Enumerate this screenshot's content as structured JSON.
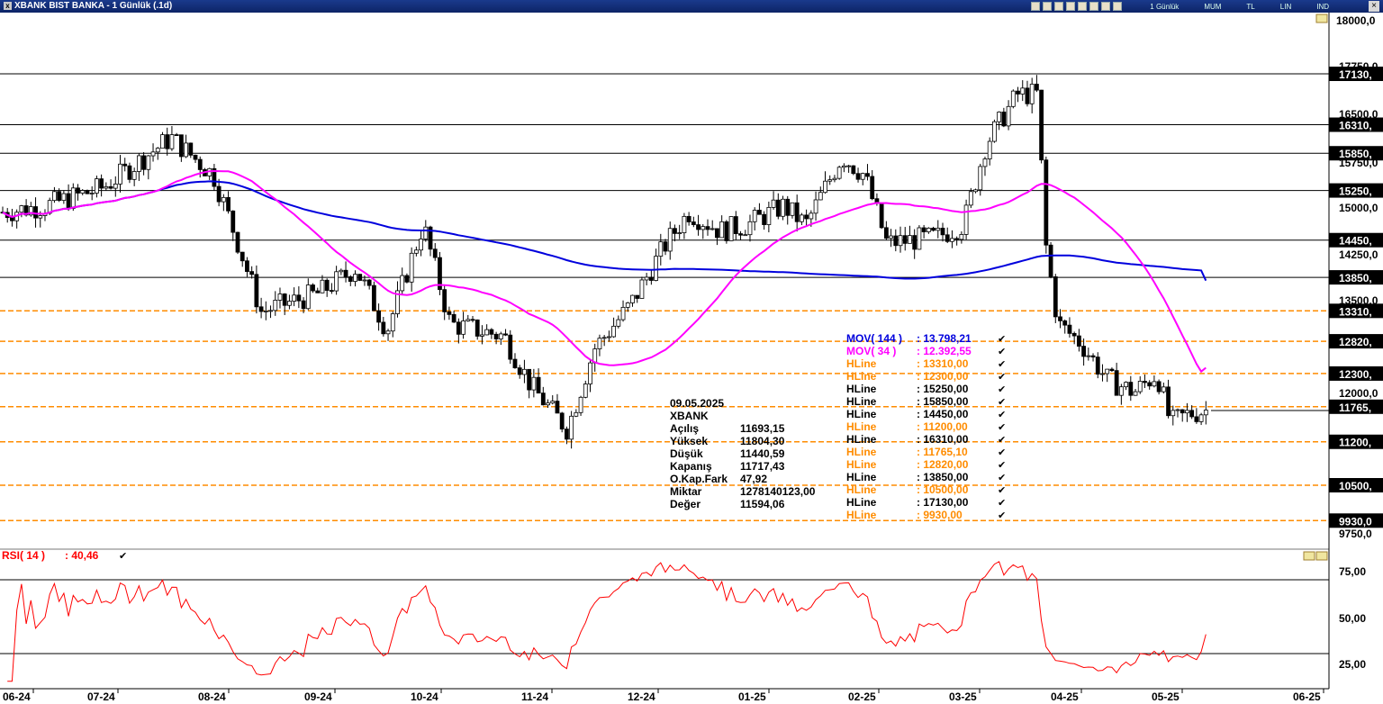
{
  "window": {
    "title": "XBANK BIST BANKA - 1 Günlük (.1d)",
    "close": "×"
  },
  "toolbar": {
    "labels": [
      "1 Günlük",
      "MUM",
      "TL",
      "LIN",
      "IND"
    ]
  },
  "colors": {
    "candle_up": "#ffffff",
    "candle_down": "#000000",
    "mov144": "#0000dd",
    "mov34": "#ff00ff",
    "hline_orange": "#ff8c00",
    "hline_black": "#000000",
    "rsi": "#ff0000"
  },
  "price_axis": {
    "ticks": [
      "18000,0",
      "17750,0",
      "16500,0",
      "15750,0",
      "15000,0",
      "14250,0",
      "13500,0",
      "12000,0",
      "9750,0"
    ]
  },
  "hline_tags": [
    "17130,",
    "16310,",
    "15850,",
    "15250,",
    "14450,",
    "13850,",
    "13310,",
    "12820,",
    "12300,",
    "11765,",
    "11200,",
    "10500,",
    "9930,0"
  ],
  "x_axis": {
    "ticks": [
      "06-24",
      "07-24",
      "08-24",
      "09-24",
      "10-24",
      "11-24",
      "12-24",
      "01-25",
      "02-25",
      "03-25",
      "04-25",
      "05-25",
      "06-25"
    ]
  },
  "rsi_axis": {
    "ticks": [
      "75,00",
      "50,00",
      "25,00"
    ]
  },
  "rsi_title": {
    "label": "RSI( 14 )",
    "value": ": 40,46"
  },
  "ohlc": {
    "date": "09.05.2025",
    "symbol": "XBANK",
    "rows": [
      {
        "k": "Açılış",
        "v": "11693,15"
      },
      {
        "k": "Yüksek",
        "v": "11804,30"
      },
      {
        "k": "Düşük",
        "v": "11440,59"
      },
      {
        "k": "Kapanış",
        "v": "11717,43"
      },
      {
        "k": "O.Kap.Fark",
        "v": "47,92"
      },
      {
        "k": "Miktar",
        "v": "1278140123,00"
      },
      {
        "k": "Değer",
        "v": "11594,06"
      }
    ]
  },
  "indicator_legend": [
    {
      "name": "MOV( 144 )",
      "value": ": 13.798,21",
      "color": "#0000dd"
    },
    {
      "name": "MOV( 34 )",
      "value": ": 12.392,55",
      "color": "#ff00ff"
    },
    {
      "name": "HLine",
      "value": ": 13310,00",
      "color": "#ff8c00"
    },
    {
      "name": "HLine",
      "value": ": 12300,00",
      "color": "#ff8c00"
    },
    {
      "name": "HLine",
      "value": ": 15250,00",
      "color": "#000000"
    },
    {
      "name": "HLine",
      "value": ": 15850,00",
      "color": "#000000"
    },
    {
      "name": "HLine",
      "value": ": 14450,00",
      "color": "#000000"
    },
    {
      "name": "HLine",
      "value": ": 11200,00",
      "color": "#ff8c00"
    },
    {
      "name": "HLine",
      "value": ": 16310,00",
      "color": "#000000"
    },
    {
      "name": "HLine",
      "value": ": 11765,10",
      "color": "#ff8c00"
    },
    {
      "name": "HLine",
      "value": ": 12820,00",
      "color": "#ff8c00"
    },
    {
      "name": "HLine",
      "value": ": 13850,00",
      "color": "#000000"
    },
    {
      "name": "HLine",
      "value": ": 10500,00",
      "color": "#ff8c00"
    },
    {
      "name": "HLine",
      "value": ": 17130,00",
      "color": "#000000"
    },
    {
      "name": "HLine",
      "value": ": 9930,00",
      "color": "#ff8c00"
    }
  ],
  "chart_data": {
    "type": "candlestick",
    "title": "XBANK BIST BANKA - 1 Günlük (.1d)",
    "x_ticks": [
      "06-24",
      "07-24",
      "08-24",
      "09-24",
      "10-24",
      "11-24",
      "12-24",
      "01-25",
      "02-25",
      "03-25",
      "04-25",
      "05-25",
      "06-25"
    ],
    "ylim": [
      9750,
      18000
    ],
    "closes_approx": [
      {
        "x": "06-24",
        "close": 14900
      },
      {
        "x": "07-24",
        "close": 15300
      },
      {
        "x": "08-24",
        "close": 15500
      },
      {
        "x": "09-24",
        "close": 13600
      },
      {
        "x": "10-24",
        "close": 13200
      },
      {
        "x": "11-24",
        "close": 11400
      },
      {
        "x": "12-24",
        "close": 14100
      },
      {
        "x": "01-25",
        "close": 14700
      },
      {
        "x": "02-25",
        "close": 14400
      },
      {
        "x": "03-25",
        "close": 16400
      },
      {
        "x": "04-25",
        "close": 12300
      },
      {
        "x": "05-25",
        "close": 11717
      }
    ],
    "hlines": [
      {
        "value": 17130,
        "style": "solid"
      },
      {
        "value": 16310,
        "style": "solid"
      },
      {
        "value": 15850,
        "style": "solid"
      },
      {
        "value": 15250,
        "style": "solid"
      },
      {
        "value": 14450,
        "style": "solid"
      },
      {
        "value": 13850,
        "style": "solid"
      },
      {
        "value": 13310,
        "style": "dashed"
      },
      {
        "value": 12820,
        "style": "dashed"
      },
      {
        "value": 12300,
        "style": "dashed"
      },
      {
        "value": 11765.1,
        "style": "dashed"
      },
      {
        "value": 11200,
        "style": "dashed"
      },
      {
        "value": 10500,
        "style": "dashed"
      },
      {
        "value": 9930,
        "style": "dashed"
      }
    ],
    "mov144": {
      "last": 13798.21
    },
    "mov34": {
      "last": 12392.55
    },
    "rsi": {
      "period": 14,
      "last": 40.46,
      "ylim": [
        15,
        85
      ],
      "levels": [
        70,
        30
      ]
    }
  }
}
